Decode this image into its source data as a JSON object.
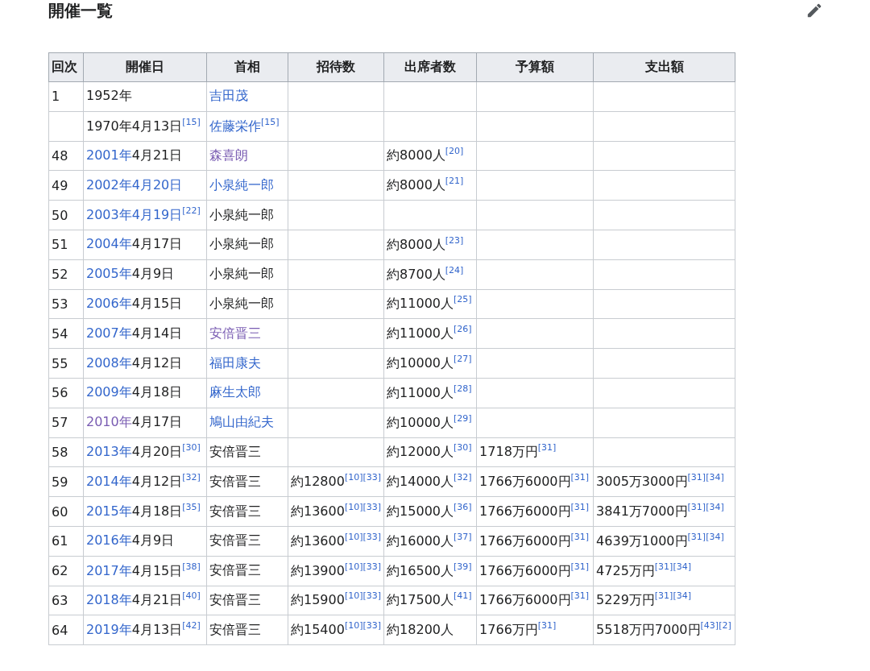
{
  "section": {
    "title": "開催一覧"
  },
  "table": {
    "columns": [
      "回次",
      "開催日",
      "首相",
      "招待数",
      "出席者数",
      "予算額",
      "支出額"
    ],
    "rows": [
      {
        "cells": [
          {
            "parts": [
              {
                "text": "1",
                "kind": "plain"
              }
            ]
          },
          {
            "parts": [
              {
                "text": "1952年",
                "kind": "plain"
              }
            ]
          },
          {
            "parts": [
              {
                "text": "吉田茂",
                "kind": "link"
              }
            ]
          },
          null,
          null,
          null,
          null
        ]
      },
      {
        "cells": [
          null,
          {
            "parts": [
              {
                "text": "1970年4月13日",
                "kind": "plain"
              }
            ],
            "refs": [
              "[15]"
            ]
          },
          {
            "parts": [
              {
                "text": "佐藤栄作",
                "kind": "link"
              }
            ],
            "refs": [
              "[15]"
            ]
          },
          null,
          null,
          null,
          null
        ]
      },
      {
        "cells": [
          {
            "parts": [
              {
                "text": "48",
                "kind": "plain"
              }
            ]
          },
          {
            "parts": [
              {
                "text": "2001年",
                "kind": "link"
              },
              {
                "text": "4月21日",
                "kind": "plain"
              }
            ]
          },
          {
            "parts": [
              {
                "text": "森喜朗",
                "kind": "visited"
              }
            ]
          },
          null,
          {
            "parts": [
              {
                "text": "約8000人",
                "kind": "plain"
              }
            ],
            "refs": [
              "[20]"
            ]
          },
          null,
          null
        ]
      },
      {
        "cells": [
          {
            "parts": [
              {
                "text": "49",
                "kind": "plain"
              }
            ]
          },
          {
            "parts": [
              {
                "text": "2002年4月20日",
                "kind": "link"
              }
            ]
          },
          {
            "parts": [
              {
                "text": "小泉純一郎",
                "kind": "link"
              }
            ]
          },
          null,
          {
            "parts": [
              {
                "text": "約8000人",
                "kind": "plain"
              }
            ],
            "refs": [
              "[21]"
            ]
          },
          null,
          null
        ]
      },
      {
        "cells": [
          {
            "parts": [
              {
                "text": "50",
                "kind": "plain"
              }
            ]
          },
          {
            "parts": [
              {
                "text": "2003年4月19日",
                "kind": "link"
              }
            ],
            "refs": [
              "[22]"
            ]
          },
          {
            "parts": [
              {
                "text": "小泉純一郎",
                "kind": "plain"
              }
            ]
          },
          null,
          null,
          null,
          null
        ]
      },
      {
        "cells": [
          {
            "parts": [
              {
                "text": "51",
                "kind": "plain"
              }
            ]
          },
          {
            "parts": [
              {
                "text": "2004年",
                "kind": "link"
              },
              {
                "text": "4月17日",
                "kind": "plain"
              }
            ]
          },
          {
            "parts": [
              {
                "text": "小泉純一郎",
                "kind": "plain"
              }
            ]
          },
          null,
          {
            "parts": [
              {
                "text": "約8000人",
                "kind": "plain"
              }
            ],
            "refs": [
              "[23]"
            ]
          },
          null,
          null
        ]
      },
      {
        "cells": [
          {
            "parts": [
              {
                "text": "52",
                "kind": "plain"
              }
            ]
          },
          {
            "parts": [
              {
                "text": "2005年",
                "kind": "link"
              },
              {
                "text": "4月9日",
                "kind": "plain"
              }
            ]
          },
          {
            "parts": [
              {
                "text": "小泉純一郎",
                "kind": "plain"
              }
            ]
          },
          null,
          {
            "parts": [
              {
                "text": "約8700人",
                "kind": "plain"
              }
            ],
            "refs": [
              "[24]"
            ]
          },
          null,
          null
        ]
      },
      {
        "cells": [
          {
            "parts": [
              {
                "text": "53",
                "kind": "plain"
              }
            ]
          },
          {
            "parts": [
              {
                "text": "2006年",
                "kind": "link"
              },
              {
                "text": "4月15日",
                "kind": "plain"
              }
            ]
          },
          {
            "parts": [
              {
                "text": "小泉純一郎",
                "kind": "plain"
              }
            ]
          },
          null,
          {
            "parts": [
              {
                "text": "約11000人",
                "kind": "plain"
              }
            ],
            "refs": [
              "[25]"
            ]
          },
          null,
          null
        ]
      },
      {
        "cells": [
          {
            "parts": [
              {
                "text": "54",
                "kind": "plain"
              }
            ]
          },
          {
            "parts": [
              {
                "text": "2007年",
                "kind": "link"
              },
              {
                "text": "4月14日",
                "kind": "plain"
              }
            ]
          },
          {
            "parts": [
              {
                "text": "安倍晋三",
                "kind": "visited"
              }
            ]
          },
          null,
          {
            "parts": [
              {
                "text": "約11000人",
                "kind": "plain"
              }
            ],
            "refs": [
              "[26]"
            ]
          },
          null,
          null
        ]
      },
      {
        "cells": [
          {
            "parts": [
              {
                "text": "55",
                "kind": "plain"
              }
            ]
          },
          {
            "parts": [
              {
                "text": "2008年",
                "kind": "link"
              },
              {
                "text": "4月12日",
                "kind": "plain"
              }
            ]
          },
          {
            "parts": [
              {
                "text": "福田康夫",
                "kind": "link"
              }
            ]
          },
          null,
          {
            "parts": [
              {
                "text": "約10000人",
                "kind": "plain"
              }
            ],
            "refs": [
              "[27]"
            ]
          },
          null,
          null
        ]
      },
      {
        "cells": [
          {
            "parts": [
              {
                "text": "56",
                "kind": "plain"
              }
            ]
          },
          {
            "parts": [
              {
                "text": "2009年",
                "kind": "link"
              },
              {
                "text": "4月18日",
                "kind": "plain"
              }
            ]
          },
          {
            "parts": [
              {
                "text": "麻生太郎",
                "kind": "link"
              }
            ]
          },
          null,
          {
            "parts": [
              {
                "text": "約11000人",
                "kind": "plain"
              }
            ],
            "refs": [
              "[28]"
            ]
          },
          null,
          null
        ]
      },
      {
        "cells": [
          {
            "parts": [
              {
                "text": "57",
                "kind": "plain"
              }
            ]
          },
          {
            "parts": [
              {
                "text": "2010年",
                "kind": "visited"
              },
              {
                "text": "4月17日",
                "kind": "plain"
              }
            ]
          },
          {
            "parts": [
              {
                "text": "鳩山由紀夫",
                "kind": "link"
              }
            ]
          },
          null,
          {
            "parts": [
              {
                "text": "約10000人",
                "kind": "plain"
              }
            ],
            "refs": [
              "[29]"
            ]
          },
          null,
          null
        ]
      },
      {
        "cells": [
          {
            "parts": [
              {
                "text": "58",
                "kind": "plain"
              }
            ]
          },
          {
            "parts": [
              {
                "text": "2013年",
                "kind": "link"
              },
              {
                "text": "4月20日",
                "kind": "plain"
              }
            ],
            "refs": [
              "[30]"
            ]
          },
          {
            "parts": [
              {
                "text": "安倍晋三",
                "kind": "plain"
              }
            ]
          },
          null,
          {
            "parts": [
              {
                "text": "約12000人",
                "kind": "plain"
              }
            ],
            "refs": [
              "[30]"
            ]
          },
          {
            "parts": [
              {
                "text": "1718万円",
                "kind": "plain"
              }
            ],
            "refs": [
              "[31]"
            ]
          },
          null
        ]
      },
      {
        "cells": [
          {
            "parts": [
              {
                "text": "59",
                "kind": "plain"
              }
            ]
          },
          {
            "parts": [
              {
                "text": "2014年",
                "kind": "link"
              },
              {
                "text": "4月12日",
                "kind": "plain"
              }
            ],
            "refs": [
              "[32]"
            ]
          },
          {
            "parts": [
              {
                "text": "安倍晋三",
                "kind": "plain"
              }
            ]
          },
          {
            "parts": [
              {
                "text": "約12800",
                "kind": "plain"
              }
            ],
            "refs": [
              "[10]",
              "[33]"
            ]
          },
          {
            "parts": [
              {
                "text": "約14000人",
                "kind": "plain"
              }
            ],
            "refs": [
              "[32]"
            ]
          },
          {
            "parts": [
              {
                "text": "1766万6000円",
                "kind": "plain"
              }
            ],
            "refs": [
              "[31]"
            ]
          },
          {
            "parts": [
              {
                "text": "3005万3000円",
                "kind": "plain"
              }
            ],
            "refs": [
              "[31]",
              "[34]"
            ]
          }
        ]
      },
      {
        "cells": [
          {
            "parts": [
              {
                "text": "60",
                "kind": "plain"
              }
            ]
          },
          {
            "parts": [
              {
                "text": "2015年",
                "kind": "link"
              },
              {
                "text": "4月18日",
                "kind": "plain"
              }
            ],
            "refs": [
              "[35]"
            ]
          },
          {
            "parts": [
              {
                "text": "安倍晋三",
                "kind": "plain"
              }
            ]
          },
          {
            "parts": [
              {
                "text": "約13600",
                "kind": "plain"
              }
            ],
            "refs": [
              "[10]",
              "[33]"
            ]
          },
          {
            "parts": [
              {
                "text": "約15000人",
                "kind": "plain"
              }
            ],
            "refs": [
              "[36]"
            ]
          },
          {
            "parts": [
              {
                "text": "1766万6000円",
                "kind": "plain"
              }
            ],
            "refs": [
              "[31]"
            ]
          },
          {
            "parts": [
              {
                "text": "3841万7000円",
                "kind": "plain"
              }
            ],
            "refs": [
              "[31]",
              "[34]"
            ]
          }
        ]
      },
      {
        "cells": [
          {
            "parts": [
              {
                "text": "61",
                "kind": "plain"
              }
            ]
          },
          {
            "parts": [
              {
                "text": "2016年",
                "kind": "link"
              },
              {
                "text": "4月9日",
                "kind": "plain"
              }
            ]
          },
          {
            "parts": [
              {
                "text": "安倍晋三",
                "kind": "plain"
              }
            ]
          },
          {
            "parts": [
              {
                "text": "約13600",
                "kind": "plain"
              }
            ],
            "refs": [
              "[10]",
              "[33]"
            ]
          },
          {
            "parts": [
              {
                "text": "約16000人",
                "kind": "plain"
              }
            ],
            "refs": [
              "[37]"
            ]
          },
          {
            "parts": [
              {
                "text": "1766万6000円",
                "kind": "plain"
              }
            ],
            "refs": [
              "[31]"
            ]
          },
          {
            "parts": [
              {
                "text": "4639万1000円",
                "kind": "plain"
              }
            ],
            "refs": [
              "[31]",
              "[34]"
            ]
          }
        ]
      },
      {
        "cells": [
          {
            "parts": [
              {
                "text": "62",
                "kind": "plain"
              }
            ]
          },
          {
            "parts": [
              {
                "text": "2017年",
                "kind": "link"
              },
              {
                "text": "4月15日",
                "kind": "plain"
              }
            ],
            "refs": [
              "[38]"
            ]
          },
          {
            "parts": [
              {
                "text": "安倍晋三",
                "kind": "plain"
              }
            ]
          },
          {
            "parts": [
              {
                "text": "約13900",
                "kind": "plain"
              }
            ],
            "refs": [
              "[10]",
              "[33]"
            ]
          },
          {
            "parts": [
              {
                "text": "約16500人",
                "kind": "plain"
              }
            ],
            "refs": [
              "[39]"
            ]
          },
          {
            "parts": [
              {
                "text": "1766万6000円",
                "kind": "plain"
              }
            ],
            "refs": [
              "[31]"
            ]
          },
          {
            "parts": [
              {
                "text": "4725万円",
                "kind": "plain"
              }
            ],
            "refs": [
              "[31]",
              "[34]"
            ]
          }
        ]
      },
      {
        "cells": [
          {
            "parts": [
              {
                "text": "63",
                "kind": "plain"
              }
            ]
          },
          {
            "parts": [
              {
                "text": "2018年",
                "kind": "link"
              },
              {
                "text": "4月21日",
                "kind": "plain"
              }
            ],
            "refs": [
              "[40]"
            ]
          },
          {
            "parts": [
              {
                "text": "安倍晋三",
                "kind": "plain"
              }
            ]
          },
          {
            "parts": [
              {
                "text": "約15900",
                "kind": "plain"
              }
            ],
            "refs": [
              "[10]",
              "[33]"
            ]
          },
          {
            "parts": [
              {
                "text": "約17500人",
                "kind": "plain"
              }
            ],
            "refs": [
              "[41]"
            ]
          },
          {
            "parts": [
              {
                "text": "1766万6000円",
                "kind": "plain"
              }
            ],
            "refs": [
              "[31]"
            ]
          },
          {
            "parts": [
              {
                "text": "5229万円",
                "kind": "plain"
              }
            ],
            "refs": [
              "[31]",
              "[34]"
            ]
          }
        ]
      },
      {
        "cells": [
          {
            "parts": [
              {
                "text": "64",
                "kind": "plain"
              }
            ]
          },
          {
            "parts": [
              {
                "text": "2019年",
                "kind": "link"
              },
              {
                "text": "4月13日",
                "kind": "plain"
              }
            ],
            "refs": [
              "[42]"
            ]
          },
          {
            "parts": [
              {
                "text": "安倍晋三",
                "kind": "plain"
              }
            ]
          },
          {
            "parts": [
              {
                "text": "約15400",
                "kind": "plain"
              }
            ],
            "refs": [
              "[10]",
              "[33]"
            ]
          },
          {
            "parts": [
              {
                "text": "約18200人",
                "kind": "plain"
              }
            ]
          },
          {
            "parts": [
              {
                "text": "1766万円",
                "kind": "plain"
              }
            ],
            "refs": [
              "[31]"
            ]
          },
          {
            "parts": [
              {
                "text": "5518万円7000円",
                "kind": "plain"
              }
            ],
            "refs": [
              "[43]",
              "[2]"
            ]
          }
        ]
      }
    ]
  }
}
